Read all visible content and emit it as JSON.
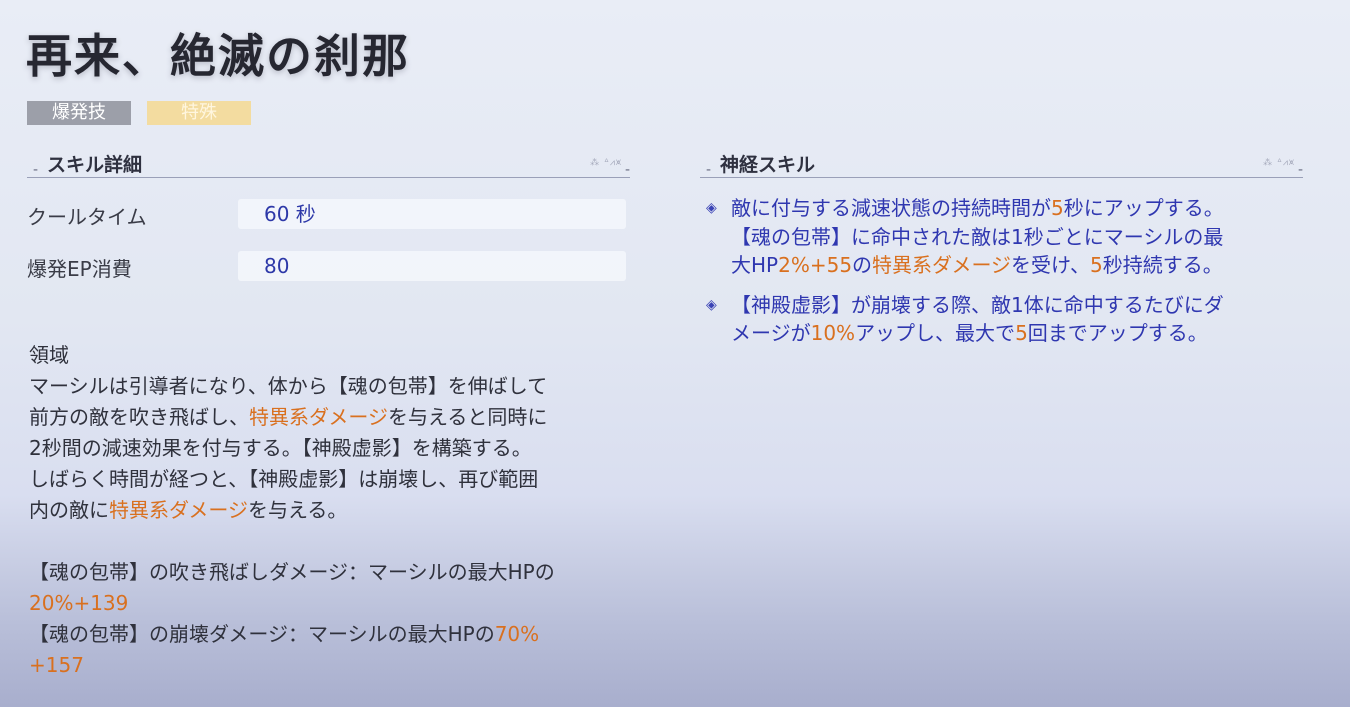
{
  "title": "再来、絶滅の刹那",
  "tags": {
    "type": "爆発技",
    "attribute": "特殊"
  },
  "skill_detail": {
    "header": "スキル詳細",
    "cooldown_label": "クールタイム",
    "cooldown_value": "60 秒",
    "ep_label": "爆発EP消費",
    "ep_value": "80"
  },
  "description": {
    "heading": "領域",
    "line1": "マーシルは引導者になり、体から【魂の包帯】を伸ばして",
    "line2_a": "前方の敵を吹き飛ばし、",
    "line2_b": "特異系ダメージ",
    "line2_c": "を与えると同時に",
    "line3": "2秒間の減速効果を付与する。【神殿虚影】を構築する。",
    "line4": "しばらく時間が経つと、【神殿虚影】は崩壊し、再び範囲",
    "line5_a": "内の敵に",
    "line5_b": "特異系ダメージ",
    "line5_c": "を与える。",
    "dmg1_text": "【魂の包帯】の吹き飛ばしダメージ：マーシルの最大HPの",
    "dmg1_value": "20%+139",
    "dmg2_text": "【魂の包帯】の崩壊ダメージ：マーシルの最大HPの",
    "dmg2_value_a": "70%",
    "dmg2_value_b": "+157"
  },
  "neural_skill": {
    "header": "神経スキル",
    "item1": {
      "t1": "敵に付与する減速状態の持続時間が",
      "n1": "5",
      "t2": "秒にアップする。",
      "t3": "【魂の包帯】に命中された敵は1秒ごとにマーシルの最",
      "t4": "大HP",
      "n2": "2%+55",
      "t5": "の",
      "n3": "特異系ダメージ",
      "t6": "を受け、",
      "n4": "5",
      "t7": "秒持続する。"
    },
    "item2": {
      "t1": "【神殿虚影】が崩壊する際、敵1体に命中するたびにダ",
      "t2": "メージが",
      "n1": "10%",
      "t3": "アップし、最大で",
      "n2": "5",
      "t4": "回までアップする。"
    }
  },
  "colors": {
    "highlight": "#d9701f",
    "neural_text": "#2f37b0",
    "tag_type_bg": "#9c9fa9",
    "tag_attr_bg": "#f3dca0"
  },
  "icons": {
    "bullet": "diamond-bullet-icon"
  }
}
